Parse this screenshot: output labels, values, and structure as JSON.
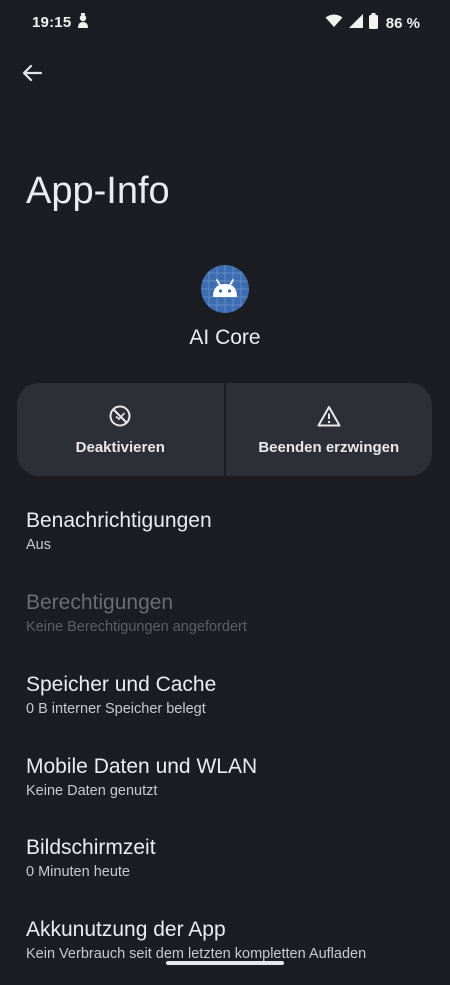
{
  "status_bar": {
    "time": "19:15",
    "battery_text": "86 %",
    "icons": [
      "notification-icon",
      "wifi-icon",
      "signal-icon",
      "battery-icon"
    ]
  },
  "header": {
    "back_icon": "arrow-back-icon",
    "title": "App-Info"
  },
  "app": {
    "name": "AI Core",
    "icon": "android-app-icon"
  },
  "actions": [
    {
      "label": "Deaktivieren",
      "icon": "disable-icon"
    },
    {
      "label": "Beenden erzwingen",
      "icon": "warning-icon"
    }
  ],
  "settings": [
    {
      "title": "Benachrichtigungen",
      "subtitle": "Aus",
      "enabled": true
    },
    {
      "title": "Berechtigungen",
      "subtitle": "Keine Berechtigungen angefordert",
      "enabled": false
    },
    {
      "title": "Speicher und Cache",
      "subtitle": "0 B interner Speicher belegt",
      "enabled": true
    },
    {
      "title": "Mobile Daten und WLAN",
      "subtitle": "Keine Daten genutzt",
      "enabled": true
    },
    {
      "title": "Bildschirmzeit",
      "subtitle": "0 Minuten heute",
      "enabled": true
    },
    {
      "title": "Akkunutzung der App",
      "subtitle": "Kein Verbrauch seit dem letzten kompletten Aufladen",
      "enabled": true
    }
  ],
  "colors": {
    "background": "#1b1d22",
    "card": "#2c2f35",
    "app_icon_bg": "#3d6db0",
    "text_primary": "#ececf0",
    "text_disabled": "#6b6d73"
  }
}
